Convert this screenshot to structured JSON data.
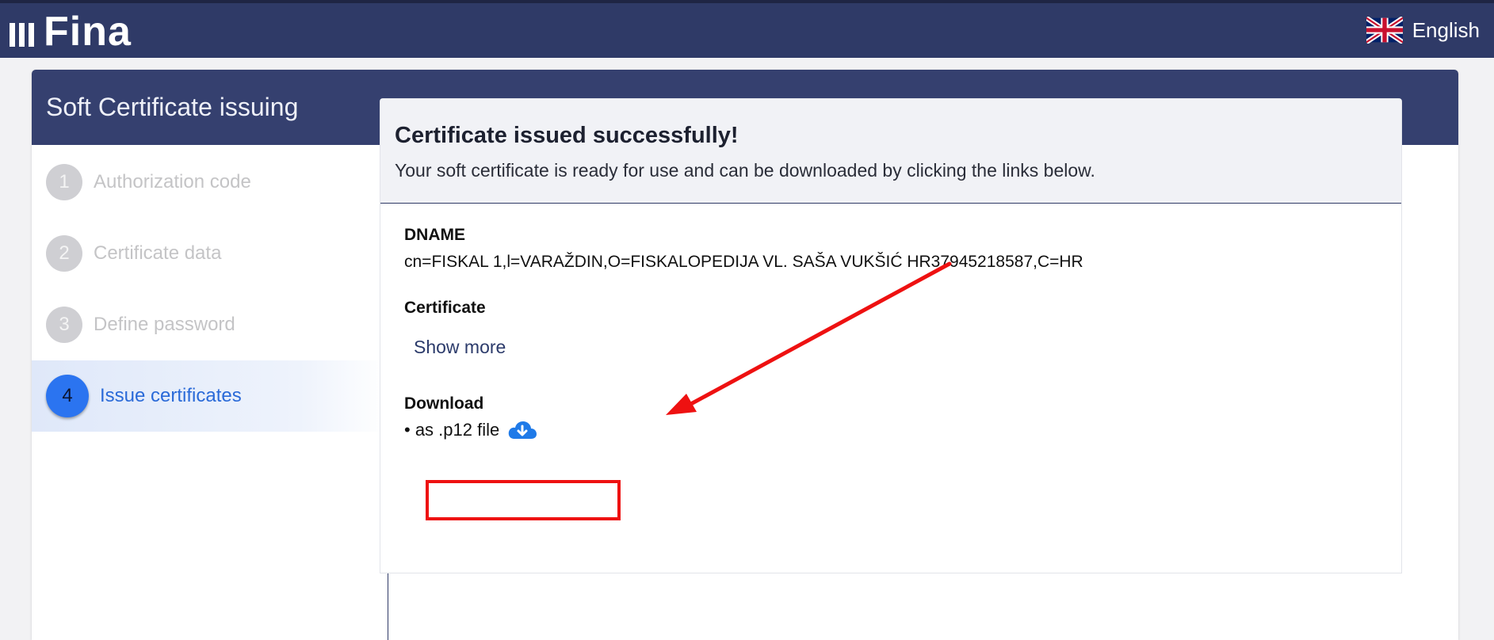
{
  "header": {
    "logo_text": "Fina",
    "language_label": "English"
  },
  "card": {
    "title": "Soft Certificate issuing"
  },
  "steps": [
    {
      "number": "1",
      "label": "Authorization code"
    },
    {
      "number": "2",
      "label": "Certificate data"
    },
    {
      "number": "3",
      "label": "Define password"
    },
    {
      "number": "4",
      "label": "Issue certificates",
      "active": true
    }
  ],
  "result": {
    "title": "Certificate issued successfully!",
    "subtitle": "Your soft certificate is ready for use and can be downloaded by clicking the links below.",
    "dname_label": "DNAME",
    "dname_value": "cn=FISKAL 1,l=VARAŽDIN,O=FISKALOPEDIJA VL. SAŠA VUKŠIĆ HR37945218587,C=HR",
    "certificate_label": "Certificate",
    "show_more_label": "Show more",
    "download_label": "Download",
    "download_p12_label": "• as .p12 file"
  },
  "icons": {
    "flag": "uk-flag-icon",
    "download": "cloud-download-icon"
  },
  "colors": {
    "brand_navy": "#2f3a67",
    "active_step": "#2b74f0",
    "annotation_red": "#ee1111"
  }
}
